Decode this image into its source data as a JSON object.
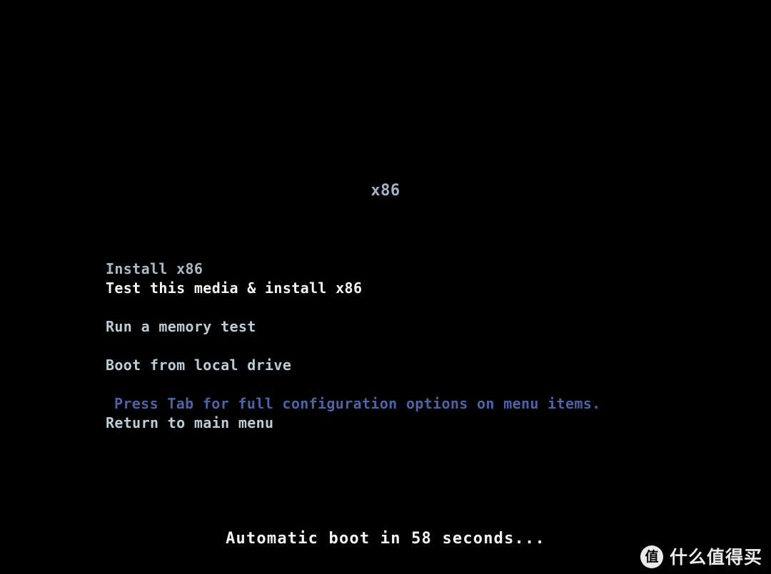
{
  "screen": {
    "background_color": "#000000",
    "title": "x86"
  },
  "menu": {
    "items": [
      {
        "label": "Install x86",
        "style": "dim"
      },
      {
        "label": "Test this media & install x86",
        "style": "highlight"
      },
      {
        "label": "",
        "style": "spacer"
      },
      {
        "label": "Run a memory test",
        "style": "normal"
      },
      {
        "label": "",
        "style": "spacer"
      },
      {
        "label": "Boot from local drive",
        "style": "normal"
      },
      {
        "label": "",
        "style": "spacer"
      },
      {
        "label": "Press Tab for full configuration options on menu items.",
        "style": "hint"
      },
      {
        "label": "Return to main menu",
        "style": "normal"
      }
    ]
  },
  "status": {
    "countdown": "Automatic boot in 58 seconds...",
    "seconds_remaining": "58"
  },
  "watermark": {
    "badge_glyph": "值",
    "text": "什么值得买"
  },
  "colors": {
    "background": "#000000",
    "title": "#9fb4cc",
    "menu_normal": "#b9cdd6",
    "menu_dim": "#a7bcc6",
    "menu_highlight": "#f4f6f6",
    "menu_hint": "#4c63a4",
    "countdown": "#f2f4f4",
    "watermark": "#f2f2f2"
  }
}
